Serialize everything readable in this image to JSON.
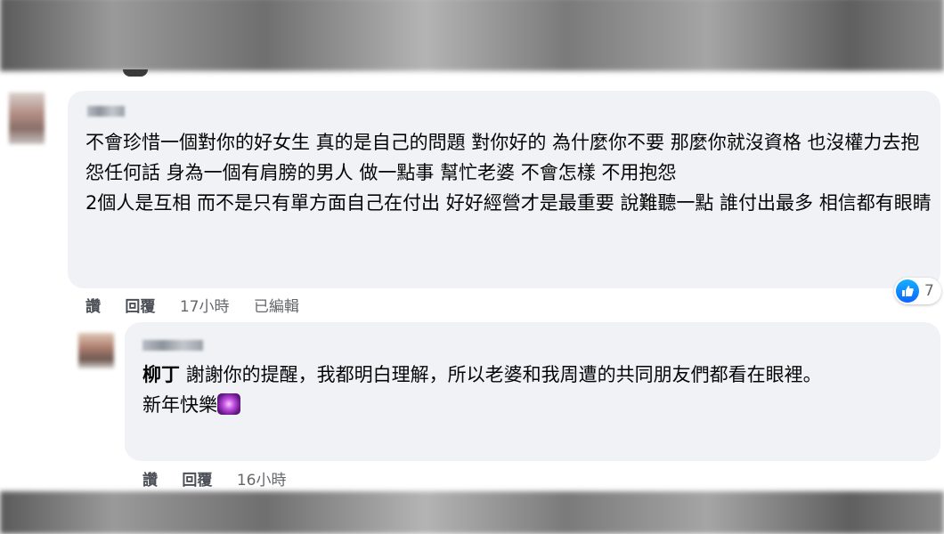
{
  "comments": [
    {
      "text": "不會珍惜一個對你的好女生 真的是自己的問題 對你好的 為什麼你不要 那麼你就沒資格 也沒權力去抱怨任何話 身為一個有肩膀的男人 做一點事 幫忙老婆 不會怎樣 不用抱怨\n2個人是互相 而不是只有單方面自己在付出 好好經營才是最重要 說難聽一點 誰付出最多 相信都有眼睛",
      "actions": {
        "like": "讚",
        "reply": "回覆",
        "time": "17小時",
        "edited": "已編輯"
      },
      "reaction": {
        "icon": "like-icon",
        "count": "7",
        "color": "#0866ff"
      }
    },
    {
      "mention": "柳丁",
      "text": " 謝謝你的提醒，我都明白理解，所以老婆和我周遭的共同朋友們都看在眼裡。\n新年快樂",
      "emoji": "sparkle-emoji-icon",
      "actions": {
        "like": "讚",
        "reply": "回覆",
        "time": "16小時"
      }
    }
  ],
  "colors": {
    "bubble": "#f0f2f5",
    "text": "#050505",
    "meta": "#65676b"
  }
}
